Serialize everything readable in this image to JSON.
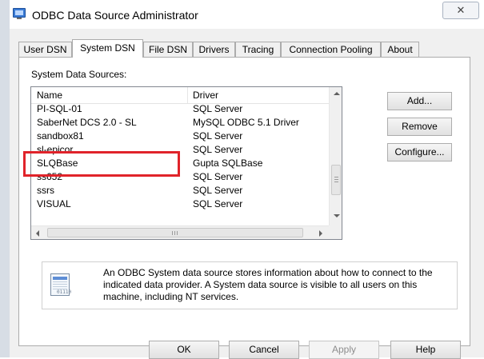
{
  "window": {
    "title": "ODBC Data Source Administrator",
    "close_glyph": "✕"
  },
  "tabs": [
    {
      "label": "User DSN",
      "active": false
    },
    {
      "label": "System DSN",
      "active": true
    },
    {
      "label": "File DSN",
      "active": false
    },
    {
      "label": "Drivers",
      "active": false
    },
    {
      "label": "Tracing",
      "active": false
    },
    {
      "label": "Connection Pooling",
      "active": false
    },
    {
      "label": "About",
      "active": false
    }
  ],
  "system_dsn": {
    "group_label": "System Data Sources:",
    "columns": {
      "name": "Name",
      "driver": "Driver"
    },
    "rows": [
      {
        "name": "PI-SQL-01",
        "driver": "SQL Server"
      },
      {
        "name": "SaberNet DCS 2.0 - SL",
        "driver": "MySQL ODBC 5.1 Driver"
      },
      {
        "name": "sandbox81",
        "driver": "SQL Server"
      },
      {
        "name": "sl-epicor",
        "driver": "SQL Server"
      },
      {
        "name": "SLQBase",
        "driver": "Gupta SQLBase"
      },
      {
        "name": "ss652",
        "driver": "SQL Server"
      },
      {
        "name": "ssrs",
        "driver": "SQL Server"
      },
      {
        "name": "VISUAL",
        "driver": "SQL Server"
      }
    ],
    "highlighted_row": "SaberNet DCS 2.0 - SL",
    "buttons": {
      "add": "Add...",
      "remove": "Remove",
      "configure": "Configure..."
    },
    "info_text": "An ODBC System data source stores information about how to connect to the indicated data provider.  A System data source is visible to all users on this machine, including NT services."
  },
  "footer_buttons": {
    "ok": "OK",
    "cancel": "Cancel",
    "apply": "Apply",
    "help": "Help"
  },
  "colors": {
    "highlight_border": "#e0232a",
    "tab_page_bg": "#ffffff",
    "dialog_bg": "#f0f0f0"
  },
  "icons": {
    "app": "monitor-icon",
    "info": "data-source-document-icon"
  }
}
